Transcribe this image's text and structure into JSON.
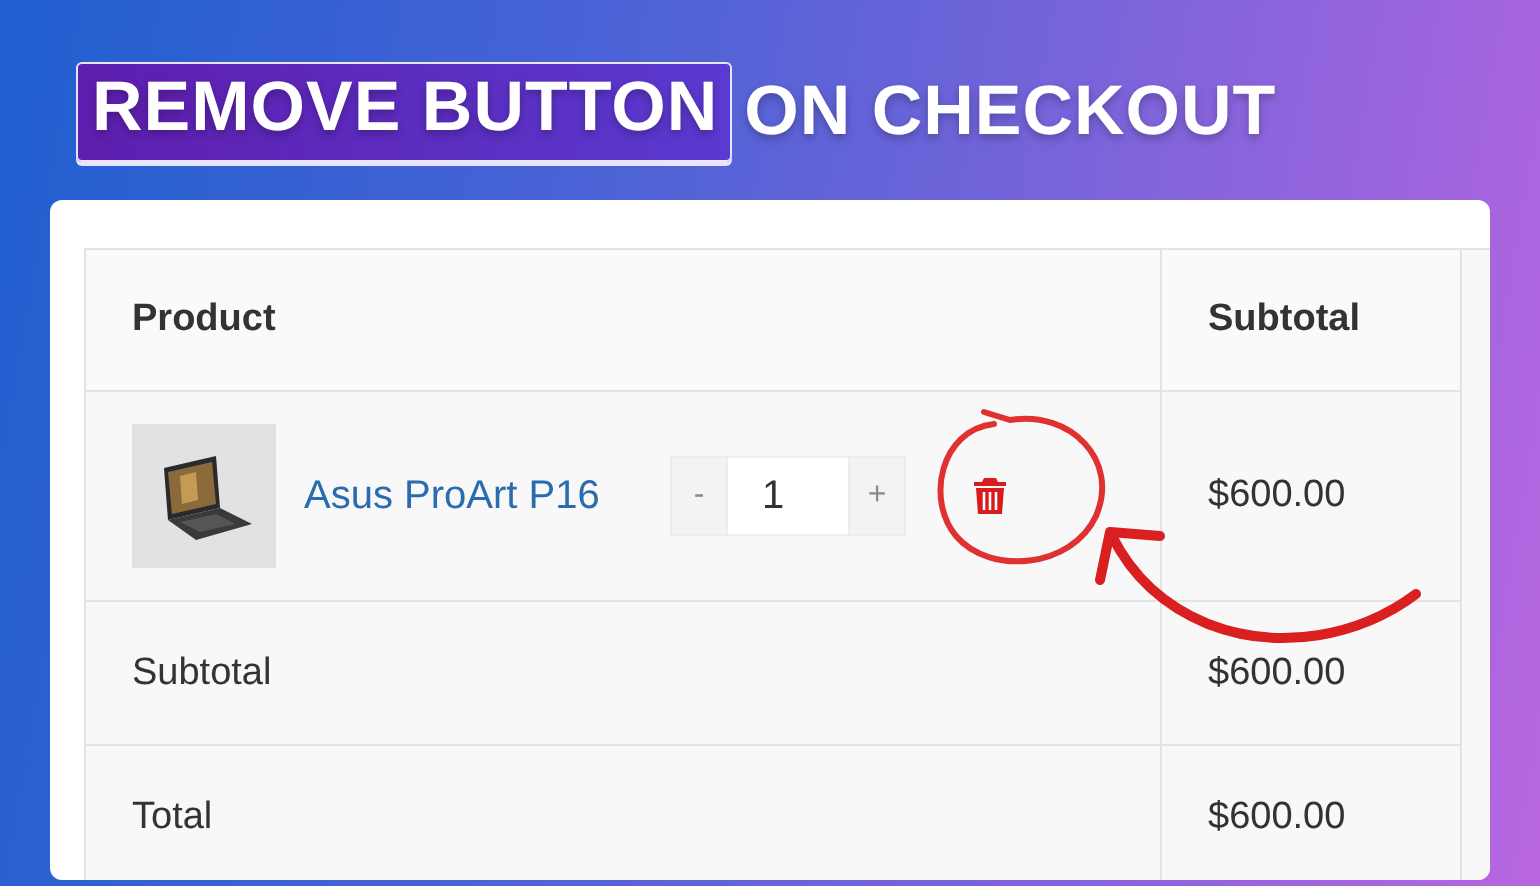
{
  "headline": {
    "highlighted": "REMOVE BUTTON",
    "rest": "ON CHECKOUT"
  },
  "cart": {
    "columns": [
      "Product",
      "Subtotal"
    ],
    "items": [
      {
        "name": "Asus ProArt P16",
        "decrement": "-",
        "quantity": "1",
        "increment": "+",
        "subtotal": "$600.00"
      }
    ],
    "totals": [
      {
        "label": "Subtotal",
        "value": "$600.00"
      },
      {
        "label": "Total",
        "value": "$600.00"
      }
    ]
  }
}
